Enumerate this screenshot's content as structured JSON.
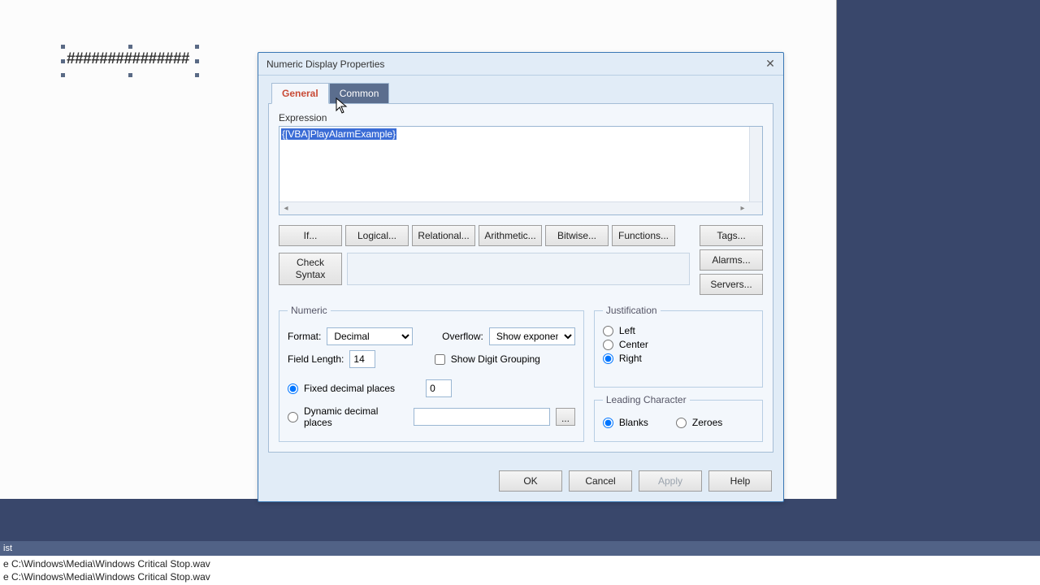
{
  "canvas": {
    "hash_text": "###############"
  },
  "dialog": {
    "title": "Numeric Display Properties",
    "tabs": {
      "general": "General",
      "common": "Common"
    },
    "expression_label": "Expression",
    "expression_value": "{[VBA]PlayAlarmExample}",
    "ops": {
      "if": "If...",
      "logical": "Logical...",
      "relational": "Relational...",
      "arithmetic": "Arithmetic...",
      "bitwise": "Bitwise...",
      "functions": "Functions..."
    },
    "sidebtns": {
      "tags": "Tags...",
      "alarms": "Alarms...",
      "servers": "Servers..."
    },
    "check_syntax": "Check\nSyntax",
    "numeric": {
      "legend": "Numeric",
      "format_label": "Format:",
      "format_value": "Decimal",
      "overflow_label": "Overflow:",
      "overflow_value": "Show exponent",
      "field_length_label": "Field Length:",
      "field_length_value": "14",
      "show_digit_grouping": "Show Digit Grouping",
      "fixed_decimal": "Fixed decimal places",
      "fixed_decimal_value": "0",
      "dynamic_decimal": "Dynamic decimal places",
      "dynamic_decimal_value": "",
      "ellipsis": "..."
    },
    "justification": {
      "legend": "Justification",
      "left": "Left",
      "center": "Center",
      "right": "Right"
    },
    "leading": {
      "legend": "Leading Character",
      "blanks": "Blanks",
      "zeroes": "Zeroes"
    },
    "buttons": {
      "ok": "OK",
      "cancel": "Cancel",
      "apply": "Apply",
      "help": "Help"
    }
  },
  "bottom": {
    "header": "ist",
    "line1": "e C:\\Windows\\Media\\Windows Critical Stop.wav",
    "line2": "e C:\\Windows\\Media\\Windows Critical Stop.wav"
  }
}
